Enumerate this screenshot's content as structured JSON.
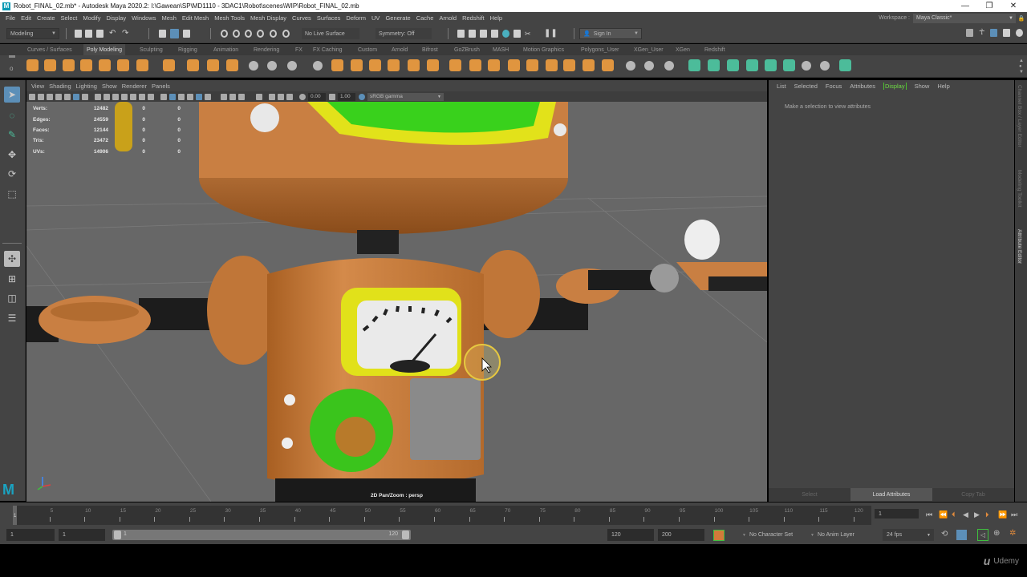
{
  "window": {
    "title": "Robot_FINAL_02.mb* - Autodesk Maya 2020.2: I:\\Gawean\\SP\\MD1110 - 3DAC1\\Robot\\scenes\\WIP\\Robot_FINAL_02.mb",
    "minimize": "—",
    "maximize": "❐",
    "close": "✕"
  },
  "menubar": [
    "File",
    "Edit",
    "Create",
    "Select",
    "Modify",
    "Display",
    "Windows",
    "Mesh",
    "Edit Mesh",
    "Mesh Tools",
    "Mesh Display",
    "Curves",
    "Surfaces",
    "Deform",
    "UV",
    "Generate",
    "Cache",
    "Arnold",
    "Redshift",
    "Help"
  ],
  "workspace": {
    "label": "Workspace :",
    "value": "Maya Classic*"
  },
  "statusline": {
    "mode": "Modeling",
    "live_surface": "No Live Surface",
    "symmetry": "Symmetry: Off",
    "sign_in": "Sign In"
  },
  "shelf_tabs": [
    "Curves / Surfaces",
    "Poly Modeling",
    "Sculpting",
    "Rigging",
    "Animation",
    "Rendering",
    "FX",
    "FX Caching",
    "Custom",
    "Arnold",
    "Bifrost",
    "GoZBrush",
    "MASH",
    "Motion Graphics",
    "Polygons_User",
    "XGen_User",
    "XGen",
    "Redshift"
  ],
  "shelf_active": "Poly Modeling",
  "viewport": {
    "menu": [
      "View",
      "Shading",
      "Lighting",
      "Show",
      "Renderer",
      "Panels"
    ],
    "exposure": "0.00",
    "gamma": "1.00",
    "color_space": "sRGB gamma",
    "camera_label": "2D Pan/Zoom : persp",
    "hud": [
      {
        "label": "Verts:",
        "value": "12482",
        "a": "0",
        "b": "0"
      },
      {
        "label": "Edges:",
        "value": "24559",
        "a": "0",
        "b": "0"
      },
      {
        "label": "Faces:",
        "value": "12144",
        "a": "0",
        "b": "0"
      },
      {
        "label": "Tris:",
        "value": "23472",
        "a": "0",
        "b": "0"
      },
      {
        "label": "UVs:",
        "value": "14906",
        "a": "0",
        "b": "0"
      }
    ]
  },
  "attribute_editor": {
    "menu": [
      "List",
      "Selected",
      "Focus",
      "Attributes",
      "Display",
      "Show",
      "Help"
    ],
    "active_menu": "Display",
    "message": "Make a selection to view attributes",
    "buttons": [
      "Select",
      "Load Attributes",
      "Copy Tab"
    ]
  },
  "side_tabs": [
    "Channel Box / Layer Editor",
    "Modeling Toolkit",
    "Attribute Editor"
  ],
  "side_tab_active": "Attribute Editor",
  "timeline": {
    "ticks": [
      "5",
      "10",
      "15",
      "20",
      "25",
      "30",
      "35",
      "40",
      "45",
      "50",
      "55",
      "60",
      "65",
      "70",
      "75",
      "80",
      "85",
      "90",
      "95",
      "100",
      "105",
      "110",
      "115",
      "120"
    ],
    "current_frame_marker": "1",
    "current_frame": "1"
  },
  "range": {
    "start": "1",
    "playback_start": "1",
    "range_min_label": "1",
    "range_max_label": "120",
    "playback_end": "120",
    "end": "200",
    "character_set": "No Character Set",
    "anim_layer": "No Anim Layer",
    "fps": "24 fps"
  },
  "watermark": "Udemy"
}
